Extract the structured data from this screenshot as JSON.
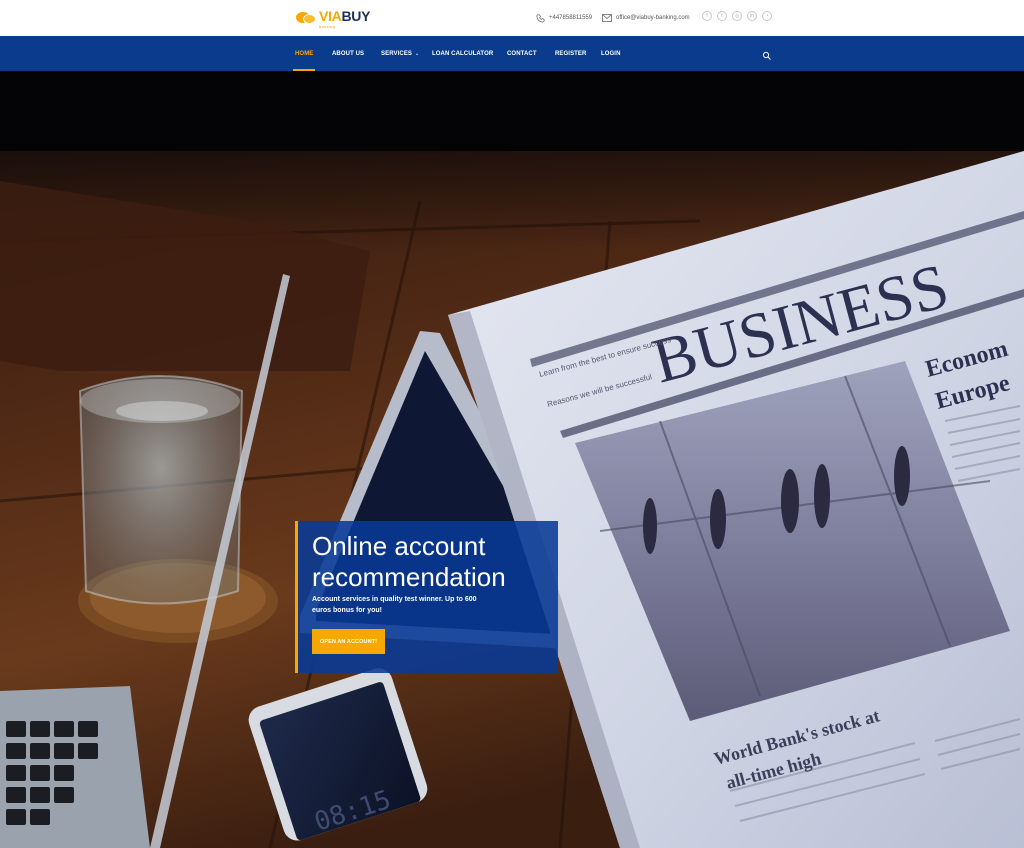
{
  "logo": {
    "part1": "VIA",
    "part2": "BUY",
    "tagline": "banking"
  },
  "topbar": {
    "phone": "+447858811559",
    "email": "office@viabuy-banking.com",
    "socials": [
      {
        "icon": "facebook-icon",
        "glyph": "f"
      },
      {
        "icon": "twitter-icon",
        "glyph": "t"
      },
      {
        "icon": "instagram-icon",
        "glyph": "◎"
      },
      {
        "icon": "linkedin-icon",
        "glyph": "in"
      },
      {
        "icon": "rss-icon",
        "glyph": "◔"
      }
    ]
  },
  "nav": {
    "items": [
      {
        "label": "HOME",
        "active": true
      },
      {
        "label": "ABOUT US"
      },
      {
        "label": "SERVICES",
        "caret": "⌄"
      },
      {
        "label": "LOAN CALCULATOR"
      },
      {
        "label": "CONTACT"
      },
      {
        "label": "REGISTER"
      },
      {
        "label": "LOGIN"
      }
    ]
  },
  "hero": {
    "title": "Online account recommendation",
    "description": "Account services in quality test winner. Up to 600 euros bonus for you!",
    "button": "OPEN AN ACCOUNT!",
    "image_text": {
      "headline": "BUSINESS",
      "tagline_1": "Learn from the best to ensure success",
      "tagline_2": "Reasons we will be successful",
      "side_headline_1": "Econom",
      "side_headline_2": "Europe",
      "article_headline_1": "World Bank's stock at",
      "article_headline_2": "all-time high",
      "phone_time": "08:15"
    }
  },
  "colors": {
    "accent": "#f7a800",
    "nav_bg": "#0a3b8c",
    "logo_dark": "#1f2f57"
  }
}
